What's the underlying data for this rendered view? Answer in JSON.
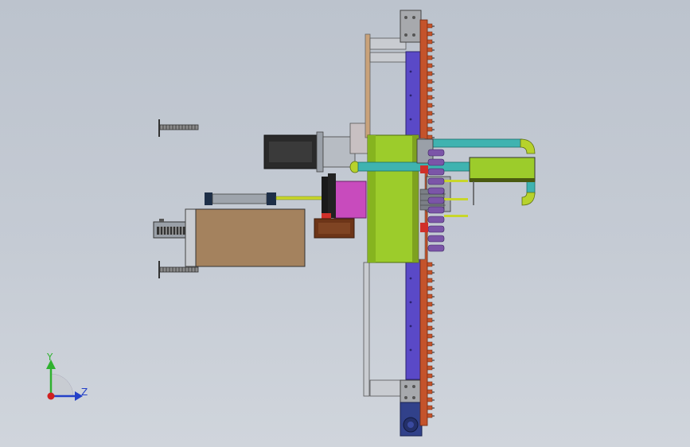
{
  "view": {
    "colors": {
      "background_top": "#bcc3cd",
      "background_bottom": "#d0d5dc",
      "frame_blue": "#5a49c7",
      "rack_orange": "#c4532b",
      "drum_green": "#9ccc2b",
      "pipe_teal": "#3fb3b0",
      "motor_black": "#2a2a2a",
      "spindle_magenta": "#c84bbd",
      "box_brown": "#a4825e",
      "gear_purple": "#7b55a8"
    }
  },
  "triad": {
    "y_label": "Y",
    "z_label": "Z",
    "y_color": "#2fb12f",
    "z_color": "#2340c8",
    "x_color": "#d02020"
  }
}
